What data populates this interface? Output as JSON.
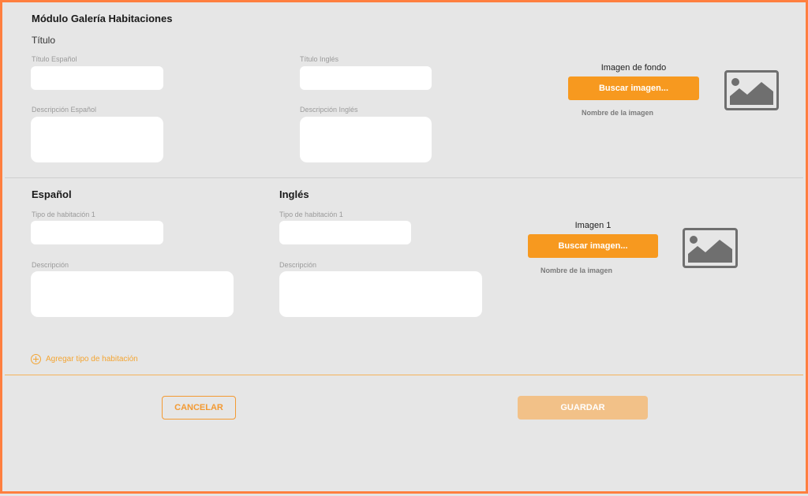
{
  "module": {
    "title": "Módulo Galería Habitaciones",
    "subtitle": "Título"
  },
  "top": {
    "title_es_label": "Título Español",
    "title_en_label": "Título Inglés",
    "desc_es_label": "Descripción Español",
    "desc_en_label": "Descripción Inglés",
    "bg_image_label": "Imagen de fondo",
    "bg_search_button": "Buscar imagen...",
    "bg_image_name": "Nombre de la imagen",
    "bg_image_icon": "image-placeholder-icon"
  },
  "rooms": {
    "es_heading": "Español",
    "en_heading": "Inglés",
    "type_es_label": "Tipo de habitación 1",
    "type_en_label": "Tipo de habitación 1",
    "desc_es_label": "Descripción",
    "desc_en_label": "Descripción",
    "image_label": "Imagen 1",
    "search_button": "Buscar imagen...",
    "image_name": "Nombre de la imagen",
    "image_icon": "image-placeholder-icon",
    "add_link": "Agregar tipo de habitación",
    "add_icon": "plus-circle-icon"
  },
  "actions": {
    "cancel": "CANCELAR",
    "save": "GUARDAR"
  },
  "colors": {
    "accent": "#f7991f",
    "frame": "#ff7f3f",
    "save_disabled": "#f2c188",
    "background": "#e6e6e6"
  }
}
